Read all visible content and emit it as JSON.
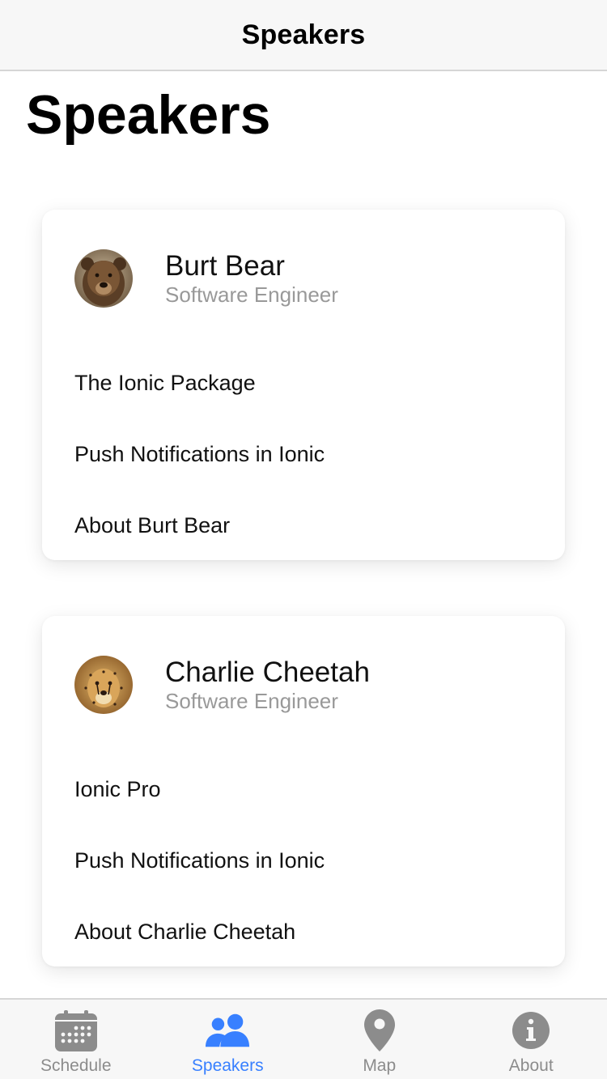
{
  "header": {
    "title": "Speakers"
  },
  "page": {
    "large_title": "Speakers"
  },
  "speakers": [
    {
      "name": "Burt Bear",
      "role": "Software Engineer",
      "avatar_icon": "bear-photo",
      "items": [
        {
          "label": "The Ionic Package"
        },
        {
          "label": "Push Notifications in Ionic"
        },
        {
          "label": "About Burt Bear"
        }
      ]
    },
    {
      "name": "Charlie Cheetah",
      "role": "Software Engineer",
      "avatar_icon": "cheetah-photo",
      "items": [
        {
          "label": "Ionic Pro"
        },
        {
          "label": "Push Notifications in Ionic"
        },
        {
          "label": "About Charlie Cheetah"
        }
      ]
    }
  ],
  "tabs": [
    {
      "label": "Schedule",
      "icon": "calendar-icon",
      "active": false
    },
    {
      "label": "Speakers",
      "icon": "people-icon",
      "active": true
    },
    {
      "label": "Map",
      "icon": "map-pin-icon",
      "active": false
    },
    {
      "label": "About",
      "icon": "info-icon",
      "active": false
    }
  ],
  "colors": {
    "accent": "#3880ff",
    "inactive": "#8c8c8c",
    "toolbar_bg": "#f7f7f7",
    "secondary_text": "#999999"
  }
}
